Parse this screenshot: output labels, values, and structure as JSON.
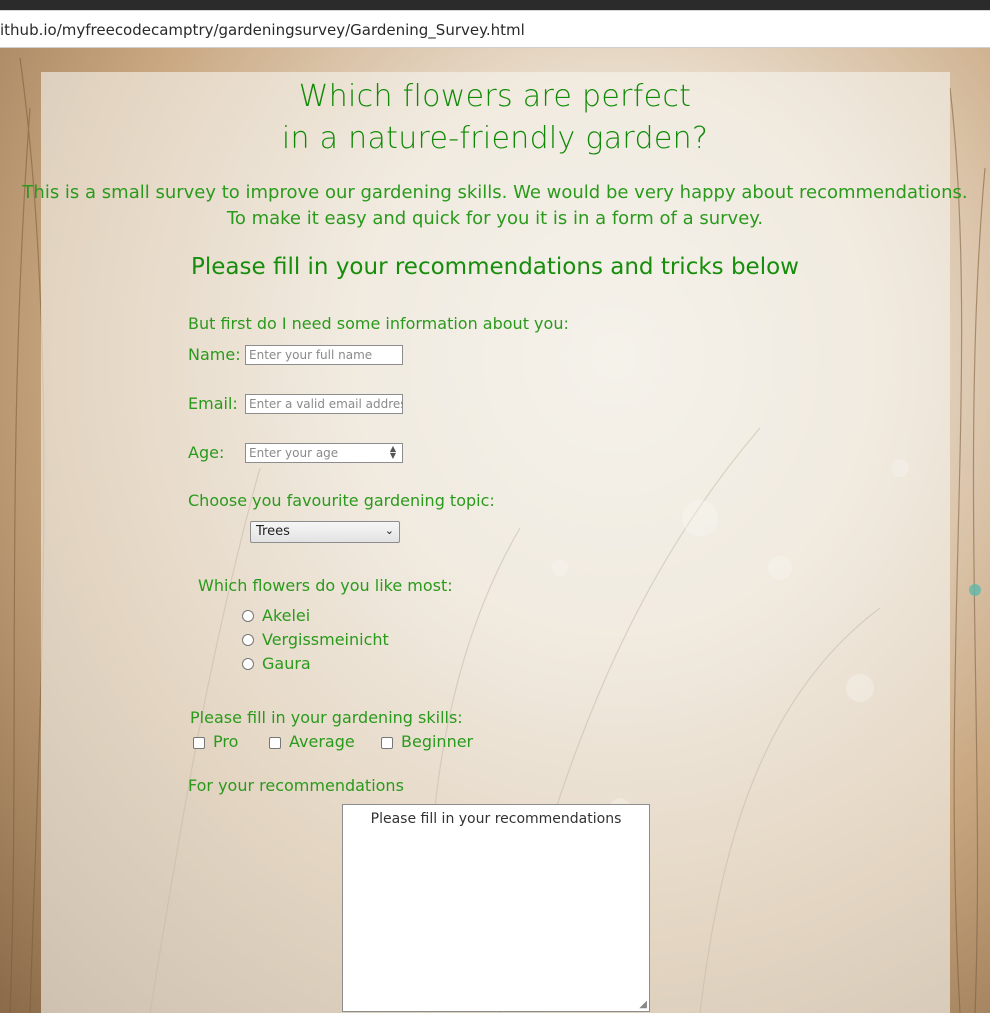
{
  "browser": {
    "url": "ithub.io/myfreecodecamptry/gardeningsurvey/Gardening_Survey.html"
  },
  "header": {
    "title_line1": "Which flowers are perfect",
    "title_line2": "in a nature-friendly garden?",
    "intro_line1": "This is a small survey to improve our gardening skills. We would be very happy about recommendations.",
    "intro_line2": "To make it easy and quick for you it is in a form of a survey.",
    "subtitle": "Please fill in your recommendations and tricks below"
  },
  "form": {
    "info_heading": "But first do I need some information about you:",
    "name": {
      "label": "Name:",
      "placeholder": "Enter your full name"
    },
    "email": {
      "label": "Email:",
      "placeholder": "Enter a valid email address"
    },
    "age": {
      "label": "Age:",
      "placeholder": "Enter your age"
    },
    "topic": {
      "label": "Choose you favourite gardening topic:",
      "selected": "Trees"
    },
    "flowers": {
      "label": "Which flowers do you like most:",
      "options": [
        "Akelei",
        "Vergissmeinicht",
        "Gaura"
      ]
    },
    "skills": {
      "label": "Please fill in your gardening skills:",
      "options": [
        "Pro",
        "Average",
        "Beginner"
      ]
    },
    "recommendations": {
      "label": "For your recommendations",
      "placeholder": "Please fill in your recommendations"
    }
  },
  "colors": {
    "accent_green": "#1c8a12",
    "panel": "#f6f3ee"
  },
  "icons": {
    "select_arrow": "chevron-down-icon",
    "spinner": "spinner-arrows-icon",
    "resize": "resize-grip-icon"
  }
}
